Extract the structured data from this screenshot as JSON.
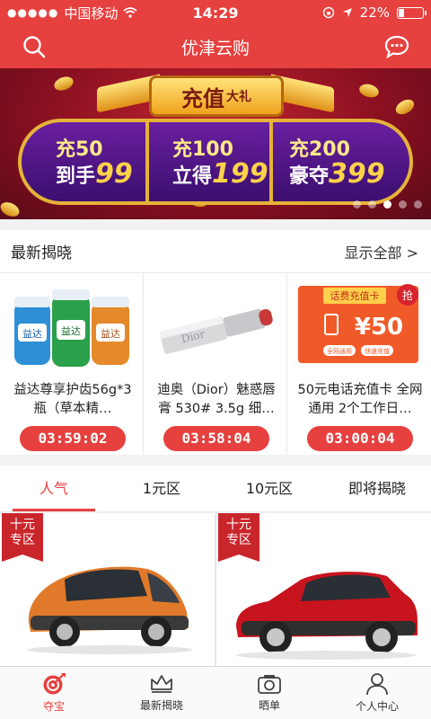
{
  "status_bar": {
    "carrier": "中国移动",
    "time": "14:29",
    "battery_percent": "22%",
    "battery_level": 0.22
  },
  "nav": {
    "title": "优津云购",
    "search_icon": "search-icon",
    "message_icon": "chat-bubble-icon"
  },
  "banner": {
    "plaque_main": "充值",
    "plaque_sub": "大礼",
    "offers": [
      {
        "line1": "充50",
        "line2_prefix": "到手",
        "line2_big": "99"
      },
      {
        "line1": "充100",
        "line2_prefix": "立得",
        "line2_big": "199"
      },
      {
        "line1": "充200",
        "line2_prefix": "豪夺",
        "line2_big": "399"
      }
    ],
    "dots_count": 5,
    "active_dot": 2
  },
  "latest": {
    "title": "最新揭晓",
    "more_label": "显示全部 >",
    "items": [
      {
        "title": "益达尊享护齿56g*3瓶（草本精…",
        "timer": "03:59:02"
      },
      {
        "title": "迪奥（Dior）魅惑唇膏 530# 3.5g 细…",
        "timer": "03:58:04"
      },
      {
        "title": "50元电话充值卡 全网通用 2个工作日…",
        "timer": "03:00:04"
      }
    ],
    "card_labels": {
      "gum_brand": "益达",
      "lipstick_brand": "Dior",
      "phone_card_header": "话费充值卡",
      "phone_card_amount": "¥50",
      "phone_card_badge": "抢",
      "phone_card_footer_1": "全网通用",
      "phone_card_footer_2": "快速充值"
    }
  },
  "tabs": [
    {
      "label": "人气",
      "active": true
    },
    {
      "label": "1元区",
      "active": false
    },
    {
      "label": "10元区",
      "active": false
    },
    {
      "label": "即将揭晓",
      "active": false
    }
  ],
  "products": [
    {
      "tag_line1": "十元",
      "tag_line2": "专区",
      "image": "orange-smart-car"
    },
    {
      "tag_line1": "十元",
      "tag_line2": "专区",
      "image": "red-nissan-sedan"
    }
  ],
  "tabbar": [
    {
      "label": "夺宝",
      "icon": "target-icon",
      "active": true
    },
    {
      "label": "最新揭晓",
      "icon": "crown-icon",
      "active": false
    },
    {
      "label": "晒单",
      "icon": "camera-icon",
      "active": false
    },
    {
      "label": "个人中心",
      "icon": "person-icon",
      "active": false
    }
  ],
  "colors": {
    "brand_red": "#e6403f",
    "banner_purple": "#4a1585",
    "gold": "#e6b23a"
  }
}
